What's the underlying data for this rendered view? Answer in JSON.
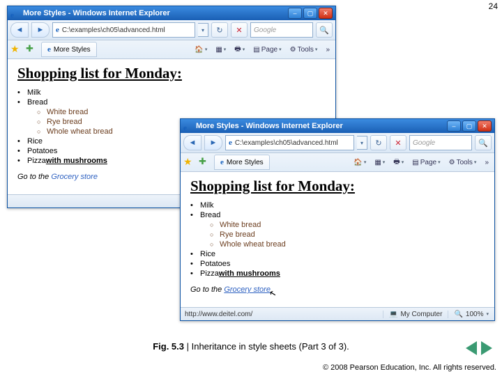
{
  "page_number": "24",
  "window": {
    "title": "More Styles - Windows Internet Explorer",
    "address": "C:\\examples\\ch05\\advanced.html",
    "search_placeholder": "Google",
    "tab_label": "More Styles",
    "tool_page": "Page",
    "tool_tools": "Tools",
    "chevron": "»"
  },
  "doc": {
    "heading": "Shopping list for Monday:",
    "items": [
      "Milk",
      "Bread",
      "Rice",
      "Potatoes"
    ],
    "bread_sub": [
      "White bread",
      "Rye bread",
      "Whole wheat bread"
    ],
    "pizza_prefix": "Pizza ",
    "pizza_em": "with mushrooms",
    "goto_prefix": "Go to the ",
    "goto_link": "Grocery store"
  },
  "status2": {
    "url": "http://www.deitel.com/",
    "zone": "My Computer",
    "zoom": "100%"
  },
  "caption_bold": "Fig. 5.3 ",
  "caption_rest": "| Inheritance in style sheets (Part 3 of 3).",
  "copyright": "© 2008 Pearson Education, Inc.  All rights reserved."
}
